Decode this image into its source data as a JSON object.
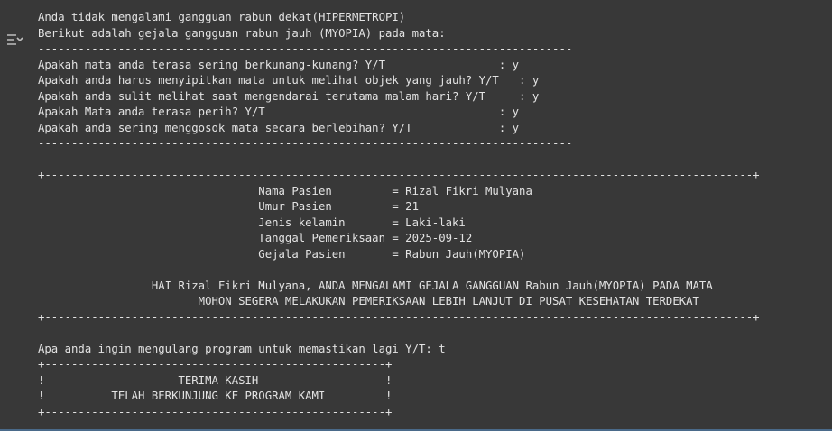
{
  "toolbar": {
    "toggle_icon": "output-collapse-icon"
  },
  "console": {
    "lines": [
      "Anda tidak mengalami gangguan rabun dekat(HIPERMETROPI)",
      "Berikut adalah gejala gangguan rabun jauh (MYOPIA) pada mata:",
      "--------------------------------------------------------------------------------",
      "Apakah mata anda terasa sering berkunang-kunang? Y/T                 : y",
      "Apakah anda harus menyipitkan mata untuk melihat objek yang jauh? Y/T   : y",
      "Apakah anda sulit melihat saat mengendarai terutama malam hari? Y/T     : y",
      "Apakah Mata anda terasa perih? Y/T                                   : y",
      "Apakah anda sering menggosok mata secara berlebihan? Y/T             : y",
      "--------------------------------------------------------------------------------",
      "",
      "+----------------------------------------------------------------------------------------------------------+",
      "                                 Nama Pasien         = Rizal Fikri Mulyana",
      "                                 Umur Pasien         = 21",
      "                                 Jenis kelamin       = Laki-laki",
      "                                 Tanggal Pemeriksaan = 2025-09-12",
      "                                 Gejala Pasien       = Rabun Jauh(MYOPIA)",
      "",
      "                 HAI Rizal Fikri Mulyana, ANDA MENGALAMI GEJALA GANGGUAN Rabun Jauh(MYOPIA) PADA MATA",
      "                        MOHON SEGERA MELAKUKAN PEMERIKSAAN LEBIH LANJUT DI PUSAT KESEHATAN TERDEKAT",
      "+----------------------------------------------------------------------------------------------------------+",
      "",
      "Apa anda ingin mengulang program untuk memastikan lagi Y/T: t",
      "+---------------------------------------------------+",
      "!                    TERIMA KASIH                   !",
      "!          TELAH BERKUNJUNG KE PROGRAM KAMI         !",
      "+---------------------------------------------------+"
    ]
  }
}
